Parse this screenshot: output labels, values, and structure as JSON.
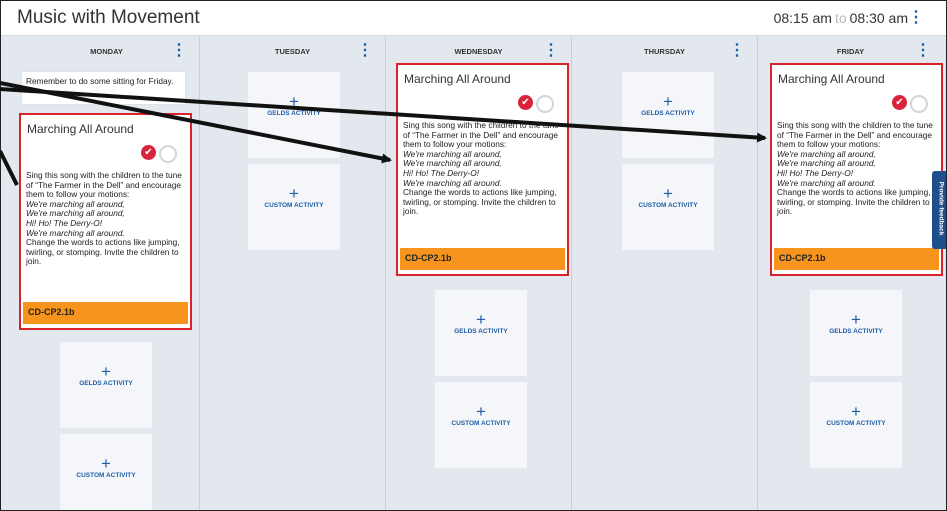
{
  "header": {
    "title": "Music with Movement",
    "time_start": "08:15 am",
    "time_sep": "to",
    "time_end": "08:30 am"
  },
  "days": [
    "MONDAY",
    "TUESDAY",
    "WEDNESDAY",
    "THURSDAY",
    "FRIDAY"
  ],
  "note": {
    "text": "Remember to do some sitting for Friday."
  },
  "tiles": {
    "geld_plus": "+",
    "geld_label": "GELDS ACTIVITY",
    "custom_plus": "+",
    "custom_label": "CUSTOM ACTIVITY"
  },
  "activity": {
    "title": "Marching All Around",
    "intro": "Sing this song with the children to the tune of “The Farmer in the Dell” and encourage them to follow your motions:",
    "lyrics": [
      "We're marching all around,",
      "We're marching all around,",
      "Hi! Ho! The Derry-O!",
      "We're marching all around."
    ],
    "outro": "Change the words to actions like jumping, twirling, or stomping. Invite the children to join.",
    "tag": "CD-CP2.1b"
  },
  "feedback": {
    "label": "Provide feedback"
  },
  "colors": {
    "accent": "#1f5fa8",
    "highlight": "#d8232a",
    "tag": "#f7941d",
    "check": "#d8233c"
  }
}
